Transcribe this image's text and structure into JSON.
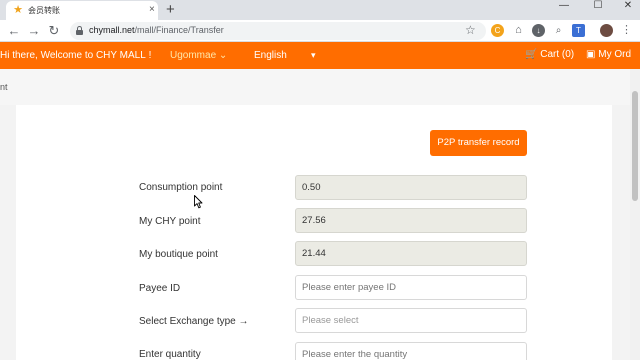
{
  "browser": {
    "tab_title": "会员转账",
    "tab_close": "×",
    "new_tab": "+",
    "url_host": "chymall.net",
    "url_path": "/mall/Finance/Transfer",
    "window_controls": [
      "—",
      "☐",
      "✕"
    ],
    "icons": [
      "back-icon",
      "forward-icon",
      "reload-icon",
      "lock-icon",
      "star-icon",
      "extension-icons",
      "profile-avatar",
      "menu-icon"
    ]
  },
  "header": {
    "welcome": "Hi there,  Welcome to CHY MALL !",
    "username": "Ugommae",
    "user_caret": "⌄",
    "language": "English",
    "language_caret": "▾",
    "cart": "Cart (0)",
    "my_order": "My Ord",
    "brand_color": "#ff6d00"
  },
  "breadcrumb": {
    "text": "nt"
  },
  "form": {
    "record_button": "P2P transfer record",
    "rows": [
      {
        "label": "Consumption point",
        "value": "0.50",
        "placeholder": ""
      },
      {
        "label": "My CHY point",
        "value": "27.56",
        "placeholder": ""
      },
      {
        "label": "My boutique point",
        "value": "21.44",
        "placeholder": ""
      },
      {
        "label": "Payee ID",
        "value": "",
        "placeholder": "Please enter payee ID"
      },
      {
        "label": "Select Exchange type →",
        "value": "",
        "placeholder": "Please select"
      },
      {
        "label": "Enter quantity",
        "value": "",
        "placeholder": "Please enter the quantity"
      }
    ]
  }
}
